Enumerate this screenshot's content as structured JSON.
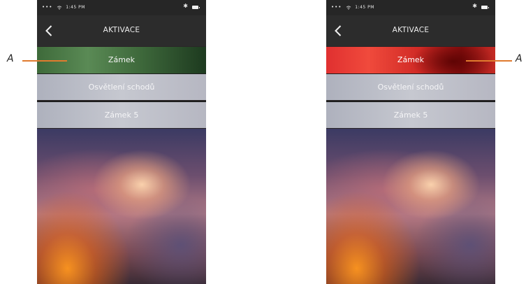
{
  "phones": [
    {
      "status": {
        "signal": "•••",
        "time": "1:45 PM",
        "bluetooth": "✱"
      },
      "nav": {
        "title": "AKTIVACE",
        "back_icon": "chevron-left-icon"
      },
      "items": [
        {
          "label": "Zámek",
          "state": "active-green"
        },
        {
          "label": "Osvětlení schodů",
          "state": "inactive"
        },
        {
          "label": "Zámek 5",
          "state": "inactive"
        }
      ]
    },
    {
      "status": {
        "signal": "•••",
        "time": "1:45 PM",
        "bluetooth": "✱"
      },
      "nav": {
        "title": "AKTIVACE",
        "back_icon": "chevron-left-icon"
      },
      "items": [
        {
          "label": "Zámek",
          "state": "active-red"
        },
        {
          "label": "Osvětlení schodů",
          "state": "inactive"
        },
        {
          "label": "Zámek 5",
          "state": "inactive"
        }
      ]
    }
  ],
  "callouts": {
    "left_label": "A",
    "right_label": "A"
  },
  "colors": {
    "active_green": "#4f7d4a",
    "active_red": "#e03a30",
    "inactive": "#bfc1ca",
    "callout": "#e07b2e"
  }
}
